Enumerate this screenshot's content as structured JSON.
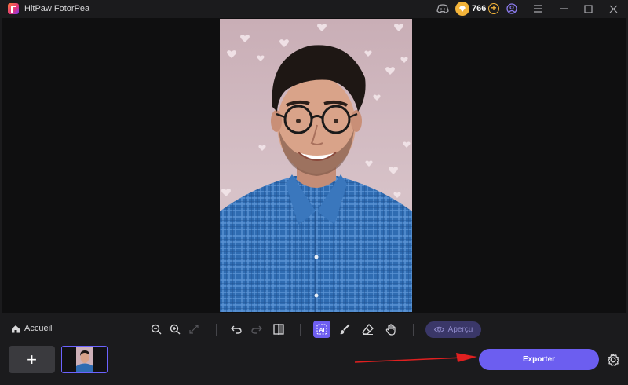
{
  "window": {
    "title": "HitPaw FotorPea",
    "coins": "766",
    "controls": [
      "discord-icon",
      "coin-icon",
      "add-coins-icon",
      "account-icon",
      "menu-icon",
      "minimize-icon",
      "maximize-icon",
      "close-icon"
    ]
  },
  "toolbar": {
    "home_label": "Accueil",
    "preview_label": "Aperçu",
    "tools": [
      "zoom-out-icon",
      "zoom-in-icon",
      "fit-screen-icon",
      "undo-icon",
      "redo-icon",
      "compare-icon",
      "ai-select-icon",
      "brush-icon",
      "eraser-icon",
      "hand-icon"
    ]
  },
  "bottom": {
    "add_label": "+",
    "export_label": "Exporter"
  },
  "colors": {
    "accent": "#6c5ef0",
    "background": "#1b1b1d",
    "canvas": "#0f0f10",
    "coin": "#f3b43a",
    "arrow": "#e02020"
  }
}
